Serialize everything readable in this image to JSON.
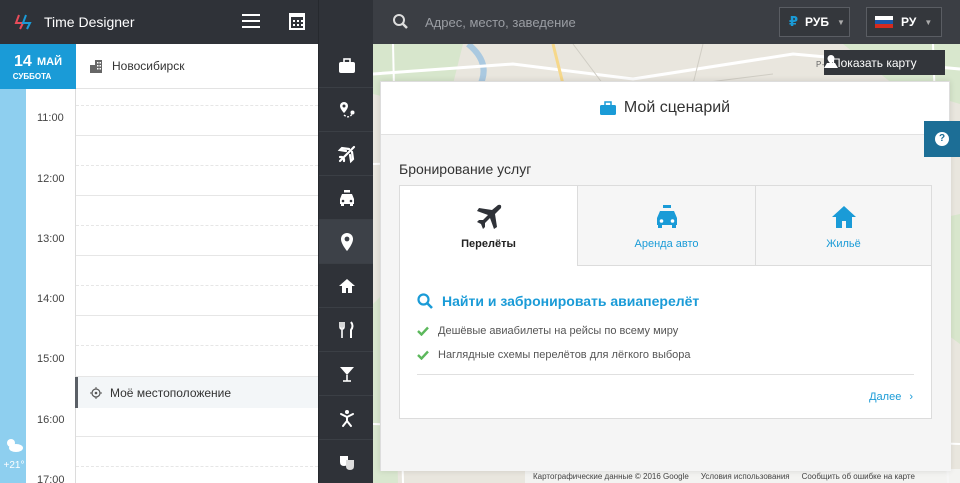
{
  "app": {
    "title": "Time Designer"
  },
  "header": {
    "search_placeholder": "Адрес, место, заведение",
    "currency": {
      "symbol": "₽",
      "label": "РУБ"
    },
    "language": {
      "label": "РУ"
    }
  },
  "calendar": {
    "day": "14",
    "month": "МАЙ",
    "weekday": "СУББОТА",
    "city": "Новосибирск",
    "hours": [
      "11:00",
      "12:00",
      "13:00",
      "14:00",
      "15:00",
      "16:00",
      "17:00"
    ],
    "location_label": "Моё местоположение",
    "weather_temp": "+21°"
  },
  "rail": {
    "items": [
      "briefcase-icon",
      "route-icon",
      "plane-icon",
      "taxi-icon",
      "location-pin-icon",
      "home-icon",
      "restaurant-icon",
      "cocktail-icon",
      "activity-icon",
      "theater-icon"
    ],
    "active_index": 4
  },
  "map": {
    "show_map_label": "Показать карту",
    "district_label": "Р-Н МЕТ",
    "footer": [
      "Картографические данные © 2016 Google",
      "Условия использования",
      "Сообщить об ошибке на карте"
    ]
  },
  "card": {
    "title": "Мой сценарий",
    "section_title": "Бронирование услуг",
    "tabs": [
      {
        "label": "Перелёты",
        "icon": "plane-icon",
        "active": true
      },
      {
        "label": "Аренда авто",
        "icon": "car-rental-icon",
        "active": false
      },
      {
        "label": "Жильё",
        "icon": "home-icon",
        "active": false
      }
    ],
    "panel_title": "Найти и забронировать авиаперелёт",
    "features": [
      "Дешёвые авиабилеты на рейсы по всему миру",
      "Наглядные схемы перелётов для лёгкого выбора"
    ],
    "next_label": "Далее",
    "next_arrow": "›"
  },
  "help": {
    "label": "?"
  },
  "colors": {
    "accent": "#1a9bd7",
    "dark": "#2f3238",
    "check": "#5cb85c"
  }
}
